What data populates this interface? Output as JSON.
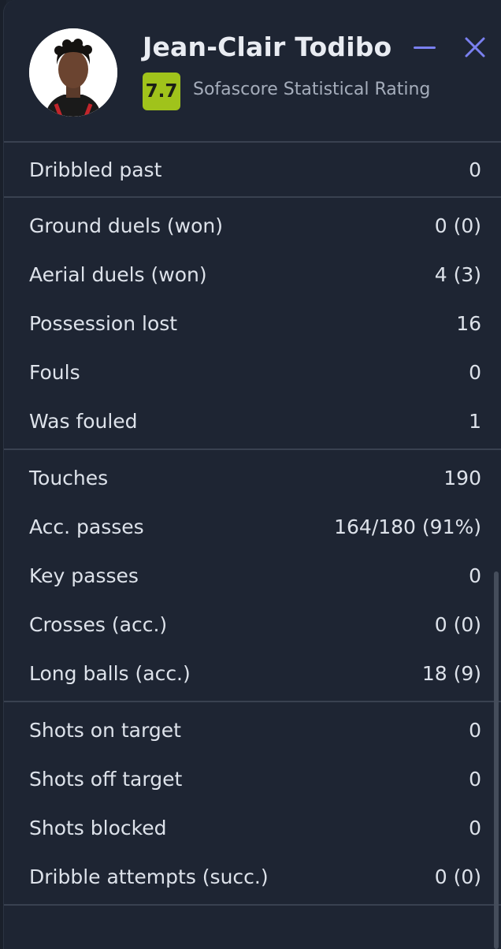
{
  "player": {
    "name": "Jean-Clair Todibo",
    "rating": "7.7",
    "rating_label": "Sofascore Statistical Rating"
  },
  "icons": {
    "minimize": "minimize-icon",
    "close": "close-icon"
  },
  "colors": {
    "accent": "#7a80f0",
    "rating_bg": "#a0c31b",
    "panel_bg": "#1e2533"
  },
  "stat_groups": [
    [
      {
        "label": "Dribbled past",
        "value": "0"
      }
    ],
    [
      {
        "label": "Ground duels (won)",
        "value": "0 (0)"
      },
      {
        "label": "Aerial duels (won)",
        "value": "4 (3)"
      },
      {
        "label": "Possession lost",
        "value": "16"
      },
      {
        "label": "Fouls",
        "value": "0"
      },
      {
        "label": "Was fouled",
        "value": "1"
      }
    ],
    [
      {
        "label": "Touches",
        "value": "190"
      },
      {
        "label": "Acc. passes",
        "value": "164/180 (91%)"
      },
      {
        "label": "Key passes",
        "value": "0"
      },
      {
        "label": "Crosses (acc.)",
        "value": "0 (0)"
      },
      {
        "label": "Long balls (acc.)",
        "value": "18 (9)"
      }
    ],
    [
      {
        "label": "Shots on target",
        "value": "0"
      },
      {
        "label": "Shots off target",
        "value": "0"
      },
      {
        "label": "Shots blocked",
        "value": "0"
      },
      {
        "label": "Dribble attempts (succ.)",
        "value": "0 (0)"
      }
    ]
  ]
}
